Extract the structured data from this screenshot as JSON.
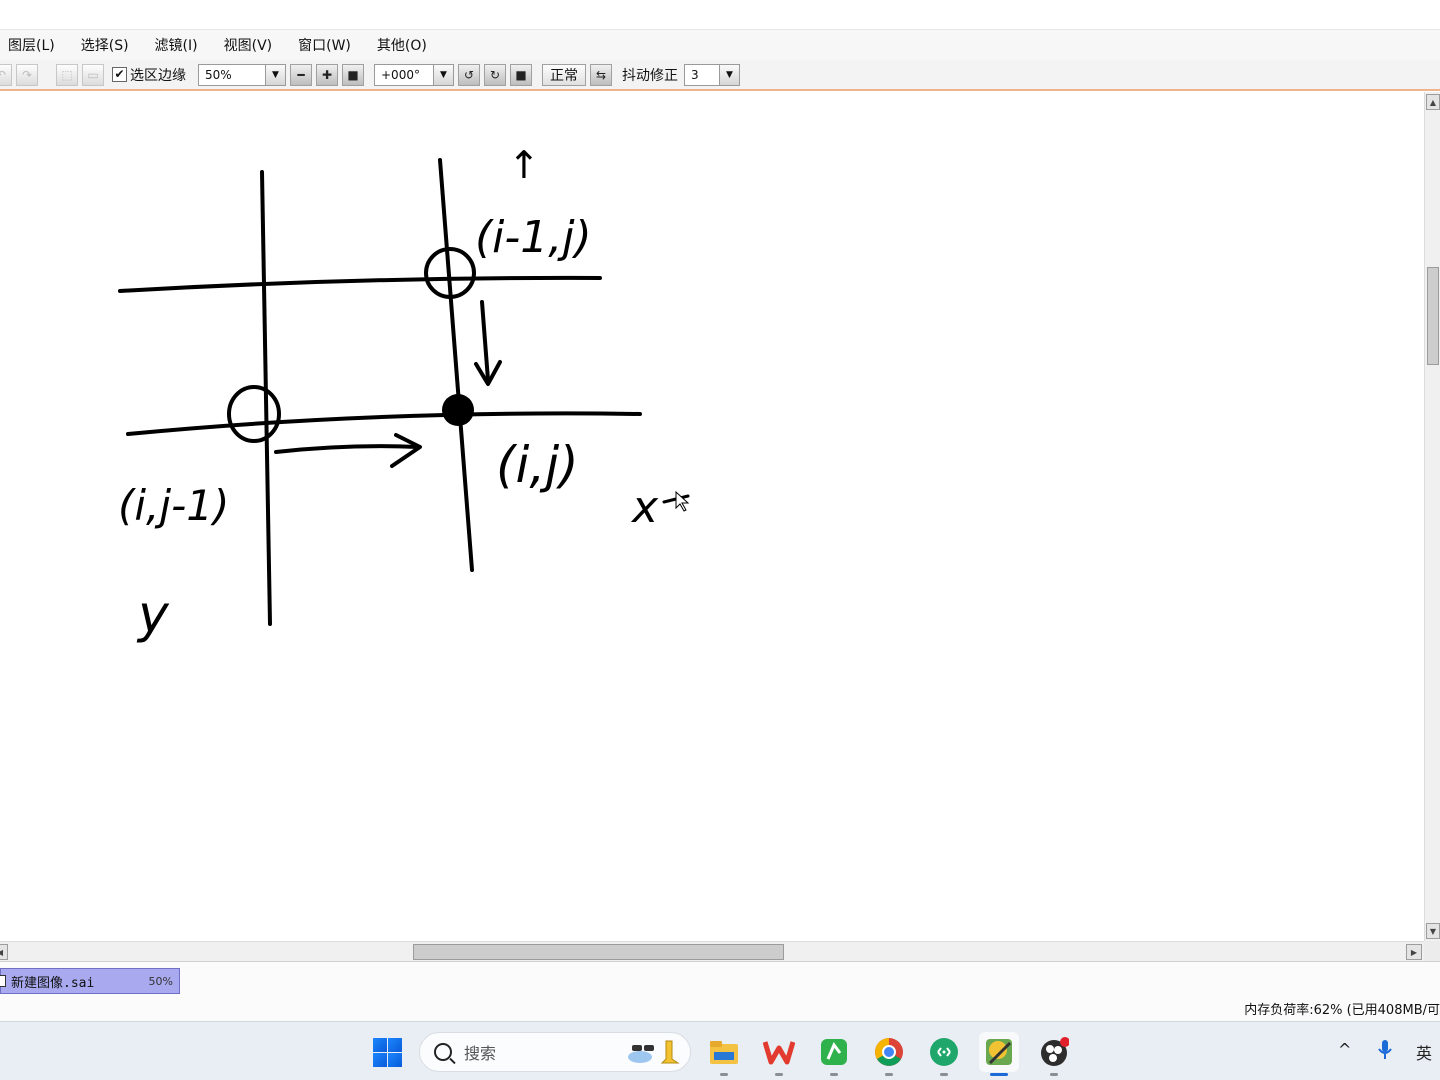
{
  "menu": [
    "图层(L)",
    "选择(S)",
    "滤镜(I)",
    "视图(V)",
    "窗口(W)",
    "其他(O)"
  ],
  "toolbar": {
    "selection_edge_label": "选区边缘",
    "selection_edge_checked": "✔",
    "zoom_value": "50%",
    "rotation_value": "+000°",
    "blend_mode": "正常",
    "stabilizer_label": "抖动修正",
    "stabilizer_value": "3"
  },
  "canvas": {
    "annotations": {
      "top_arrow_label": "↑",
      "top_point_label": "(i-1,j)",
      "center_point_label": "(i,j)",
      "left_point_label": "(i,j-1)",
      "x_axis_label": "x",
      "y_axis_label": "y"
    }
  },
  "document": {
    "tab_name": "新建图像.sai",
    "tab_zoom": "50%"
  },
  "status": {
    "memory": "内存负荷率:62% (已用408MB/可"
  },
  "taskbar": {
    "search_placeholder": "搜索",
    "apps": [
      "file-explorer",
      "wps-office",
      "green-app",
      "chrome",
      "remote-app",
      "paint-tool-sai",
      "obs"
    ],
    "tray": {
      "chevron": "^",
      "ime": "英"
    }
  }
}
